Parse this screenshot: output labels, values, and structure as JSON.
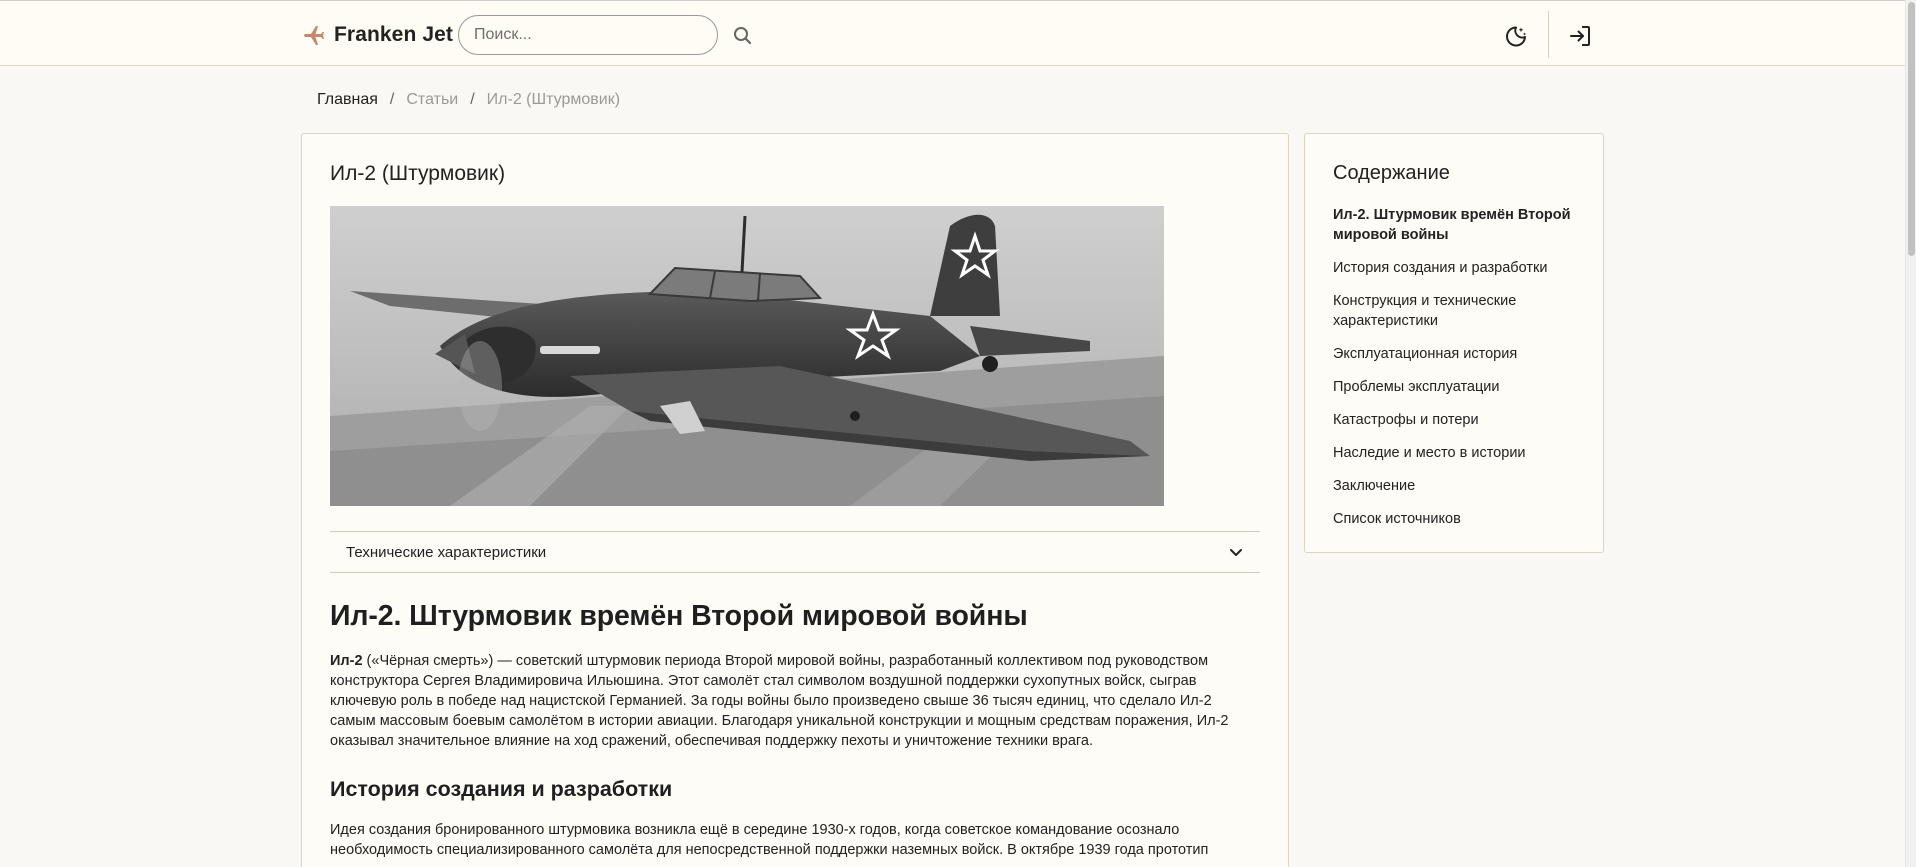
{
  "header": {
    "brand_name": "Franken Jet",
    "search_placeholder": "Поиск..."
  },
  "breadcrumb": {
    "home": "Главная",
    "section": "Статьи",
    "current": "Ил-2 (Штурмовик)",
    "separator": "/"
  },
  "article": {
    "card_title": "Ил-2 (Штурмовик)",
    "specs_toggle_label": "Технические характеристики",
    "heading": "Ил-2. Штурмовик времён Второй мировой войны",
    "intro_bold": "Ил-2",
    "intro_text": " («Чёрная смерть») — советский штурмовик периода Второй мировой войны, разработанный коллективом под руководством конструктора Сергея Владимировича Ильюшина. Этот самолёт стал символом воздушной поддержки сухопутных войск, сыграв ключевую роль в победе над нацистской Германией. За годы войны было произведено свыше 36 тысяч единиц, что сделало Ил-2 самым массовым боевым самолётом в истории авиации. Благодаря уникальной конструкции и мощным средствам поражения, Ил-2 оказывал значительное влияние на ход сражений, обеспечивая поддержку пехоты и уничтожение техники врага.",
    "section_heading": "История создания и разработки",
    "section_text": "Идея создания бронированного штурмовика возникла ещё в середине 1930-х годов, когда советское командование осознало необходимость специализированного самолёта для непосредственной поддержки наземных войск. В октябре 1939 года прототип"
  },
  "toc": {
    "title": "Содержание",
    "items": [
      "Ил-2. Штурмовик времён Второй мировой войны",
      "История создания и разработки",
      "Конструкция и технические характеристики",
      "Эксплуатационная история",
      "Проблемы эксплуатации",
      "Катастрофы и потери",
      "Наследие и место в истории",
      "Заключение",
      "Список источников"
    ]
  },
  "icons": {
    "brand": "airplane-icon",
    "search": "search-icon",
    "theme": "moon-star-icon",
    "login": "login-icon",
    "toggle": "chevron-down-icon"
  },
  "colors": {
    "page_background": "#f9f8f4",
    "header_background": "#fefcf4",
    "card_border": "#e2d3bd",
    "brand_icon": "#c8886a"
  }
}
